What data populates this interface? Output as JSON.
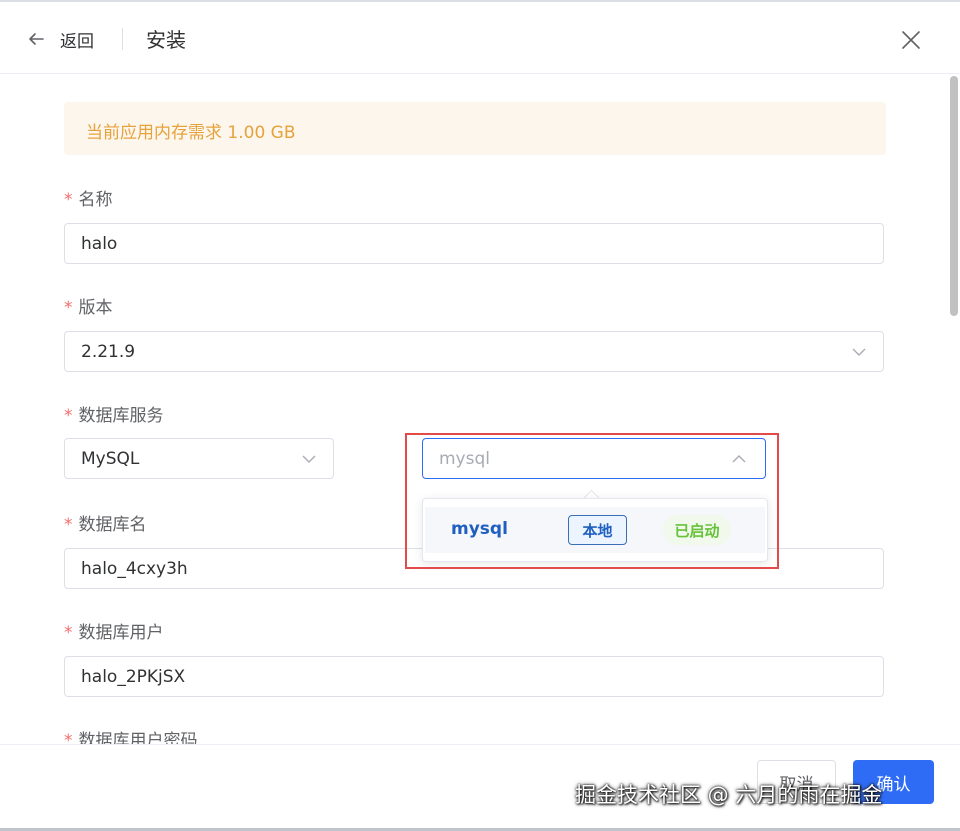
{
  "header": {
    "back_label": "返回",
    "title": "安装"
  },
  "alert": {
    "text": "当前应用内存需求 1.00 GB"
  },
  "form": {
    "name": {
      "label": "名称",
      "value": "halo"
    },
    "version": {
      "label": "版本",
      "value": "2.21.9"
    },
    "db_service": {
      "label": "数据库服务",
      "type_value": "MySQL",
      "instance_placeholder": "mysql"
    },
    "db_name": {
      "label": "数据库名",
      "value": "halo_4cxy3h"
    },
    "db_user": {
      "label": "数据库用户",
      "value": "halo_2PKjSX"
    },
    "db_password": {
      "label": "数据库用户密码"
    }
  },
  "dropdown": {
    "options": [
      {
        "name": "mysql",
        "tag": "本地",
        "status": "已启动"
      }
    ]
  },
  "footer": {
    "cancel_label": "取消",
    "confirm_label": "确认"
  },
  "watermark": "掘金技术社区 @ 六月的雨在掘金",
  "colors": {
    "primary": "#2f6cf6",
    "warning": "#e6a23c",
    "success": "#67c23a",
    "danger": "#f56c6c",
    "highlight": "#e24b4b"
  },
  "icons": {
    "back": "arrow-left-icon",
    "close": "close-icon",
    "select": "chevron-down-icon",
    "select_open": "chevron-up-icon"
  }
}
